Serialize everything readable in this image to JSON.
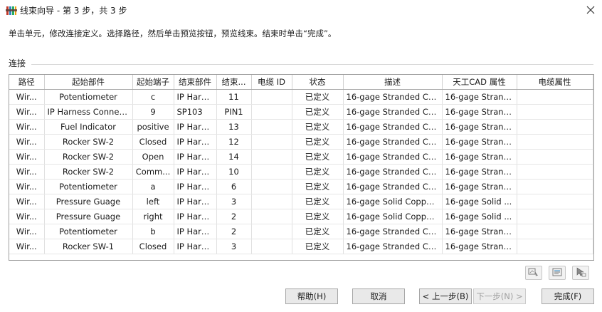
{
  "window": {
    "title": "线束向导 - 第 3 步，共 3 步"
  },
  "instructions": "单击单元，修改连接定义。选择路径，然后单击预览按钮，预览线束。结束时单击“完成”。",
  "section_label": "连接",
  "table": {
    "columns": [
      "路径",
      "起始部件",
      "起始端子",
      "结束部件",
      "结束...",
      "电缆 ID",
      "状态",
      "描述",
      "天工CAD 属性",
      "电缆属性"
    ],
    "rows": [
      [
        "Wir...",
        "Potentiometer",
        "c",
        "IP Harn...",
        "11",
        "",
        "已定义",
        "16-gage Stranded Co...",
        "16-gage Strand...",
        ""
      ],
      [
        "Wir...",
        "IP Harness Connec...",
        "9",
        "SP103",
        "PIN1",
        "",
        "已定义",
        "16-gage Stranded Co...",
        "16-gage Strand...",
        ""
      ],
      [
        "Wir...",
        "Fuel Indicator",
        "positive",
        "IP Harn...",
        "13",
        "",
        "已定义",
        "16-gage Stranded Co...",
        "16-gage Strand...",
        ""
      ],
      [
        "Wir...",
        "Rocker SW-2",
        "Closed",
        "IP Harn...",
        "12",
        "",
        "已定义",
        "16-gage Stranded Co...",
        "16-gage Strand...",
        ""
      ],
      [
        "Wir...",
        "Rocker SW-2",
        "Open",
        "IP Harn...",
        "14",
        "",
        "已定义",
        "16-gage Stranded Co...",
        "16-gage Strand...",
        ""
      ],
      [
        "Wir...",
        "Rocker SW-2",
        "Comm...",
        "IP Harn...",
        "10",
        "",
        "已定义",
        "16-gage Stranded Co...",
        "16-gage Strand...",
        ""
      ],
      [
        "Wir...",
        "Potentiometer",
        "a",
        "IP Harn...",
        "6",
        "",
        "已定义",
        "16-gage Stranded Co...",
        "16-gage Strand...",
        ""
      ],
      [
        "Wir...",
        "Pressure Guage",
        "left",
        "IP Harn...",
        "3",
        "",
        "已定义",
        "16-gage Solid Coppe...",
        "16-gage Solid ...",
        ""
      ],
      [
        "Wir...",
        "Pressure Guage",
        "right",
        "IP Harn...",
        "2",
        "",
        "已定义",
        "16-gage Solid Coppe...",
        "16-gage Solid ...",
        ""
      ],
      [
        "Wir...",
        "Potentiometer",
        "b",
        "IP Harn...",
        "2",
        "",
        "已定义",
        "16-gage Stranded Co...",
        "16-gage Strand...",
        ""
      ],
      [
        "Wir...",
        "Rocker SW-1",
        "Closed",
        "IP Harn...",
        "3",
        "",
        "已定义",
        "16-gage Stranded Co...",
        "16-gage Strand...",
        ""
      ]
    ]
  },
  "icons": {
    "app": "wire-harness-app-icon",
    "close": "close-icon",
    "tool1": "preview-path-icon",
    "tool2": "properties-list-icon",
    "tool3": "select-pointer-icon"
  },
  "buttons": {
    "help": "帮助(H)",
    "cancel": "取消",
    "back": "< 上一步(B)",
    "next": "下一步(N) >",
    "finish": "完成(F)"
  }
}
